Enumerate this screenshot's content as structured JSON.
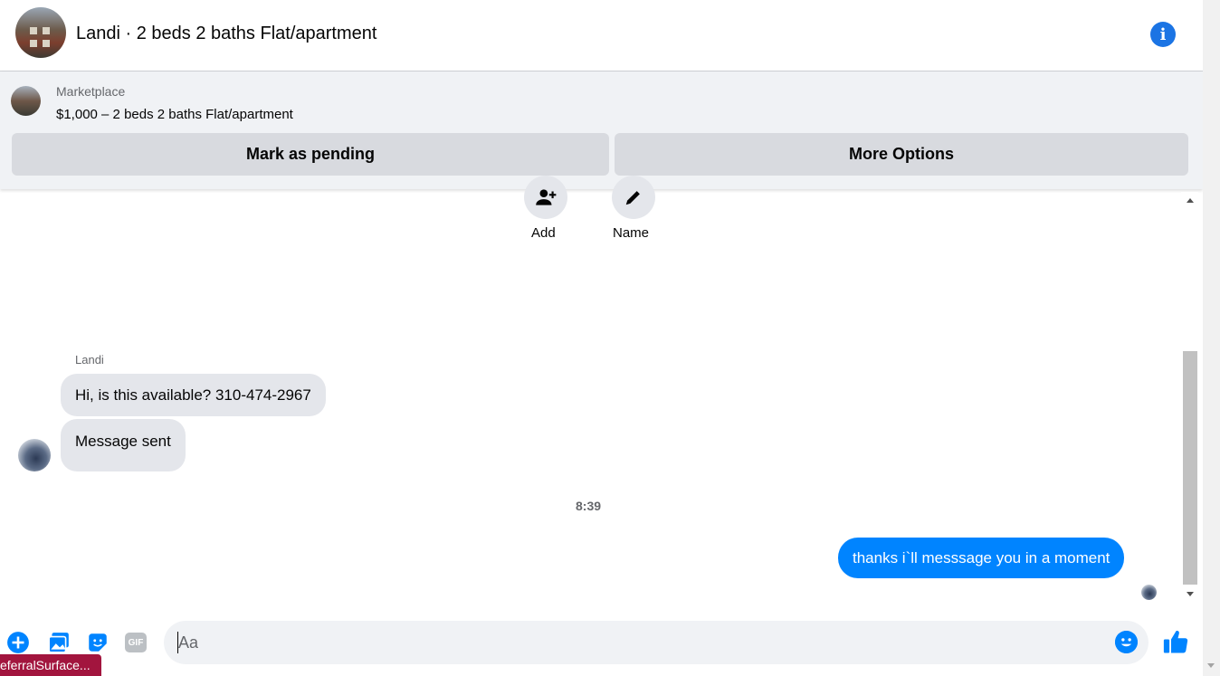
{
  "header": {
    "title": "Landi · 2 beds 2 baths Flat/apartment",
    "info_icon": "info-icon"
  },
  "marketplace": {
    "label": "Marketplace",
    "listing": "$1,000 – 2 beds 2 baths Flat/apartment",
    "mark_pending_label": "Mark as pending",
    "more_options_label": "More Options"
  },
  "chat_actions": [
    {
      "label": "Add",
      "icon": "add-person-icon"
    },
    {
      "label": "Name",
      "icon": "pencil-icon"
    }
  ],
  "messages": {
    "sender_name": "Landi",
    "incoming": [
      "Hi, is this available? 310-474-2967",
      "Message sent"
    ],
    "timestamp": "8:39",
    "outgoing": "thanks i`ll messsage you in a moment"
  },
  "composer": {
    "placeholder": "Aa",
    "icons": [
      "plus-icon",
      "photo-icon",
      "sticker-icon",
      "gif-icon",
      "emoji-icon",
      "thumbs-up-icon"
    ],
    "gif_label": "GIF",
    "accent": "#0084ff"
  },
  "status_tag": "eferralSurface..."
}
